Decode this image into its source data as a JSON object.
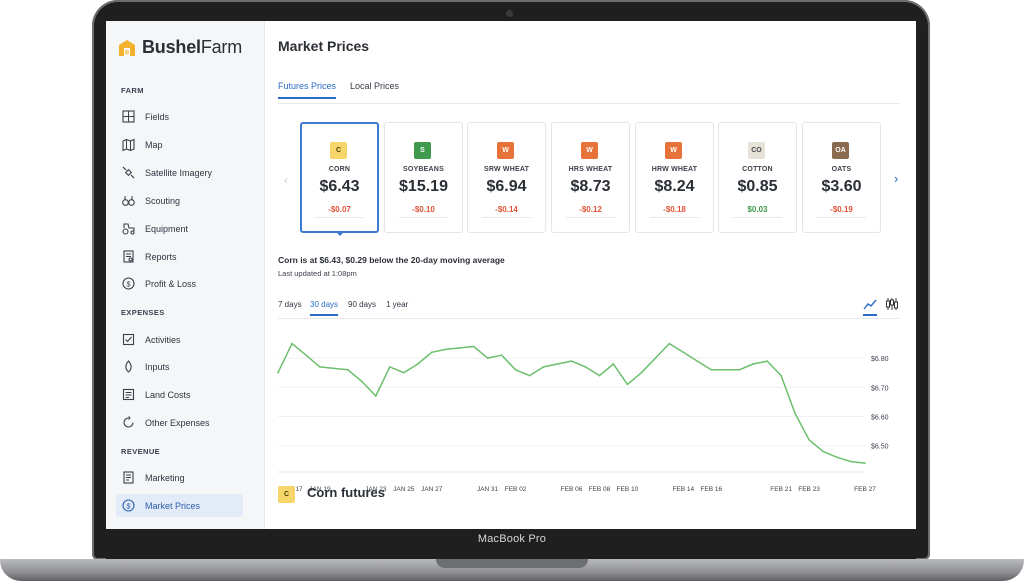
{
  "device": {
    "label": "MacBook Pro"
  },
  "app": {
    "logo_bold": "Bushel",
    "logo_light": "Farm"
  },
  "sidebar": {
    "sections": [
      {
        "title": "FARM",
        "items": [
          {
            "label": "Fields",
            "icon": "fields-icon"
          },
          {
            "label": "Map",
            "icon": "map-icon"
          },
          {
            "label": "Satellite Imagery",
            "icon": "satellite-icon"
          },
          {
            "label": "Scouting",
            "icon": "binoculars-icon"
          },
          {
            "label": "Equipment",
            "icon": "tractor-icon"
          },
          {
            "label": "Reports",
            "icon": "reports-icon"
          },
          {
            "label": "Profit & Loss",
            "icon": "dollar-icon"
          }
        ]
      },
      {
        "title": "EXPENSES",
        "items": [
          {
            "label": "Activities",
            "icon": "activities-icon"
          },
          {
            "label": "Inputs",
            "icon": "inputs-icon"
          },
          {
            "label": "Land Costs",
            "icon": "land-costs-icon"
          },
          {
            "label": "Other Expenses",
            "icon": "other-expenses-icon"
          }
        ]
      },
      {
        "title": "REVENUE",
        "items": [
          {
            "label": "Marketing",
            "icon": "marketing-icon"
          },
          {
            "label": "Market Prices",
            "icon": "market-prices-icon",
            "active": true
          }
        ]
      }
    ]
  },
  "header": {
    "title": "Market Prices"
  },
  "tabs": [
    {
      "label": "Futures Prices",
      "active": true
    },
    {
      "label": "Local Prices",
      "active": false
    }
  ],
  "commodities": [
    {
      "code": "C",
      "name": "CORN",
      "price": "$6.43",
      "change": "-$0.07",
      "direction": "neg",
      "color": "#f6d66b",
      "text_color": "#4b3d00",
      "selected": true
    },
    {
      "code": "S",
      "name": "SOYBEANS",
      "price": "$15.19",
      "change": "-$0.10",
      "direction": "neg",
      "color": "#3f9a4e",
      "text_color": "#ffffff"
    },
    {
      "code": "W",
      "name": "SRW WHEAT",
      "price": "$6.94",
      "change": "-$0.14",
      "direction": "neg",
      "color": "#e8733a",
      "text_color": "#ffffff"
    },
    {
      "code": "W",
      "name": "HRS WHEAT",
      "price": "$8.73",
      "change": "-$0.12",
      "direction": "neg",
      "color": "#e8733a",
      "text_color": "#ffffff"
    },
    {
      "code": "W",
      "name": "HRW WHEAT",
      "price": "$8.24",
      "change": "-$0.18",
      "direction": "neg",
      "color": "#e8733a",
      "text_color": "#ffffff"
    },
    {
      "code": "CO",
      "name": "COTTON",
      "price": "$0.85",
      "change": "$0.03",
      "direction": "pos",
      "color": "#e6e2d8",
      "text_color": "#4a4a4a"
    },
    {
      "code": "OA",
      "name": "OATS",
      "price": "$3.60",
      "change": "-$0.19",
      "direction": "neg",
      "color": "#8b6b4f",
      "text_color": "#ffffff"
    }
  ],
  "summary": {
    "text": "Corn is at $6.43, $0.29 below the 20-day moving average",
    "updated": "Last updated at 1:08pm"
  },
  "ranges": [
    {
      "label": "7 days",
      "active": false
    },
    {
      "label": "30 days",
      "active": true
    },
    {
      "label": "90 days",
      "active": false
    },
    {
      "label": "1 year",
      "active": false
    }
  ],
  "chart_data": {
    "type": "line",
    "color": "#6cbf6c",
    "x": [
      "JAN 16",
      "JAN 17",
      "JAN 18",
      "JAN 19",
      "JAN 20",
      "JAN 21",
      "JAN 22",
      "JAN 23",
      "JAN 24",
      "JAN 25",
      "JAN 26",
      "JAN 27",
      "JAN 28",
      "JAN 29",
      "JAN 30",
      "JAN 31",
      "FEB 01",
      "FEB 02",
      "FEB 03",
      "FEB 04",
      "FEB 05",
      "FEB 06",
      "FEB 07",
      "FEB 08",
      "FEB 09",
      "FEB 10",
      "FEB 11",
      "FEB 12",
      "FEB 13",
      "FEB 14",
      "FEB 15",
      "FEB 16",
      "FEB 17",
      "FEB 18",
      "FEB 19",
      "FEB 20",
      "FEB 21",
      "FEB 22",
      "FEB 23",
      "FEB 24",
      "FEB 25",
      "FEB 26",
      "FEB 27"
    ],
    "y": [
      6.75,
      6.85,
      6.81,
      6.77,
      6.765,
      6.76,
      6.72,
      6.67,
      6.77,
      6.75,
      6.78,
      6.82,
      6.83,
      6.835,
      6.84,
      6.8,
      6.81,
      6.76,
      6.74,
      6.77,
      6.78,
      6.79,
      6.77,
      6.74,
      6.78,
      6.71,
      6.75,
      6.8,
      6.85,
      6.82,
      6.79,
      6.76,
      6.76,
      6.76,
      6.78,
      6.79,
      6.74,
      6.61,
      6.52,
      6.48,
      6.46,
      6.445,
      6.44
    ],
    "x_ticks": [
      "JAN 17",
      "JAN 19",
      "JAN 23",
      "JAN 25",
      "JAN 27",
      "JAN 31",
      "FEB 02",
      "FEB 06",
      "FEB 08",
      "FEB 10",
      "FEB 14",
      "FEB 16",
      "FEB 21",
      "FEB 23",
      "FEB 27"
    ],
    "y_ticks": [
      "$6.80",
      "$6.70",
      "$6.60",
      "$6.50"
    ],
    "ylim": [
      6.43,
      6.9
    ],
    "grid": "horizontal"
  },
  "futures": {
    "badge": "C",
    "title": "Corn futures"
  }
}
